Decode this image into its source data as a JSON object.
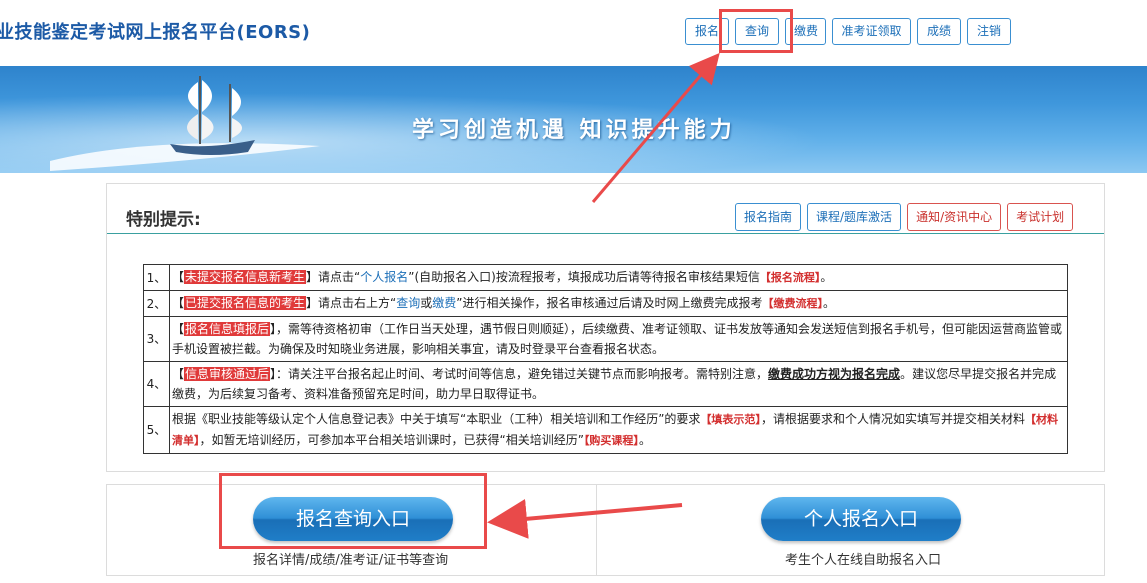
{
  "header": {
    "title": "业技能鉴定考试网上报名平台(EORS)",
    "nav": [
      "报名",
      "查询",
      "缴费",
      "准考证领取",
      "成绩",
      "注销"
    ]
  },
  "banner": {
    "slogan": "学习创造机遇  知识提升能力"
  },
  "panel": {
    "title": "特别提示:",
    "guide_buttons": [
      "报名指南",
      "课程/题库激活",
      "通知/资讯中心",
      "考试计划"
    ],
    "rows": [
      {
        "num": "1、",
        "tag": "未提交报名信息新考生",
        "parts": [
          "】请点击“",
          "个人报名",
          "”(自助报名入口)按流程报考，填报成功后请等待报名审核结果短信",
          "【报名流程】",
          "。"
        ]
      },
      {
        "num": "2、",
        "tag": "已提交报名信息的考生",
        "parts": [
          "】请点击右上方“",
          "查询",
          "或",
          "缴费",
          "”进行相关操作，报名审核通过后请及时网上缴费完成报考",
          "【缴费流程】",
          "。"
        ]
      },
      {
        "num": "3、",
        "tag": "报名信息填报后",
        "parts": [
          "】，需等待资格初审（工作日当天处理，遇节假日则顺延），后续缴费、准考证领取、证书发放等通知会发送短信到报名手机号，但可能因运营商监管或手机设置被拦截。为确保及时知晓业务进展，影响相关事宜，请及时登录平台查看报名状态。"
        ]
      },
      {
        "num": "4、",
        "tag": "信息审核通过后",
        "parts": [
          "】：请关注平台报名起止时间、考试时间等信息，避免错过关键节点而影响报考。需特别注意，",
          "缴费成功方视为报名完成",
          "。建议您尽早提交报名并完成缴费，为后续复习备考、资料准备预留充足时间，助力早日取得证书。"
        ]
      },
      {
        "num": "5、",
        "parts": [
          "根据《职业技能等级认定个人信息登记表》中关于填写“本职业（工种）相关培训和工作经历”的要求",
          "【填表示范】",
          "，请根据要求和个人情况如实填写并提交相关材料",
          "【材料清单】",
          "，如暂无培训经历，可参加本平台相关培训课时，已获得“相关培训经历”",
          "【购买课程】",
          "。"
        ]
      }
    ]
  },
  "entries": {
    "query": {
      "label": "报名查询入口",
      "sub": "报名详情/成绩/准考证/证书等查询"
    },
    "personal": {
      "label": "个人报名入口",
      "sub": "考生个人在线自助报名入口"
    }
  },
  "colors": {
    "accent": "#1c6fb8",
    "highlight": "#e94a4a",
    "tag": "#e03a3a"
  }
}
